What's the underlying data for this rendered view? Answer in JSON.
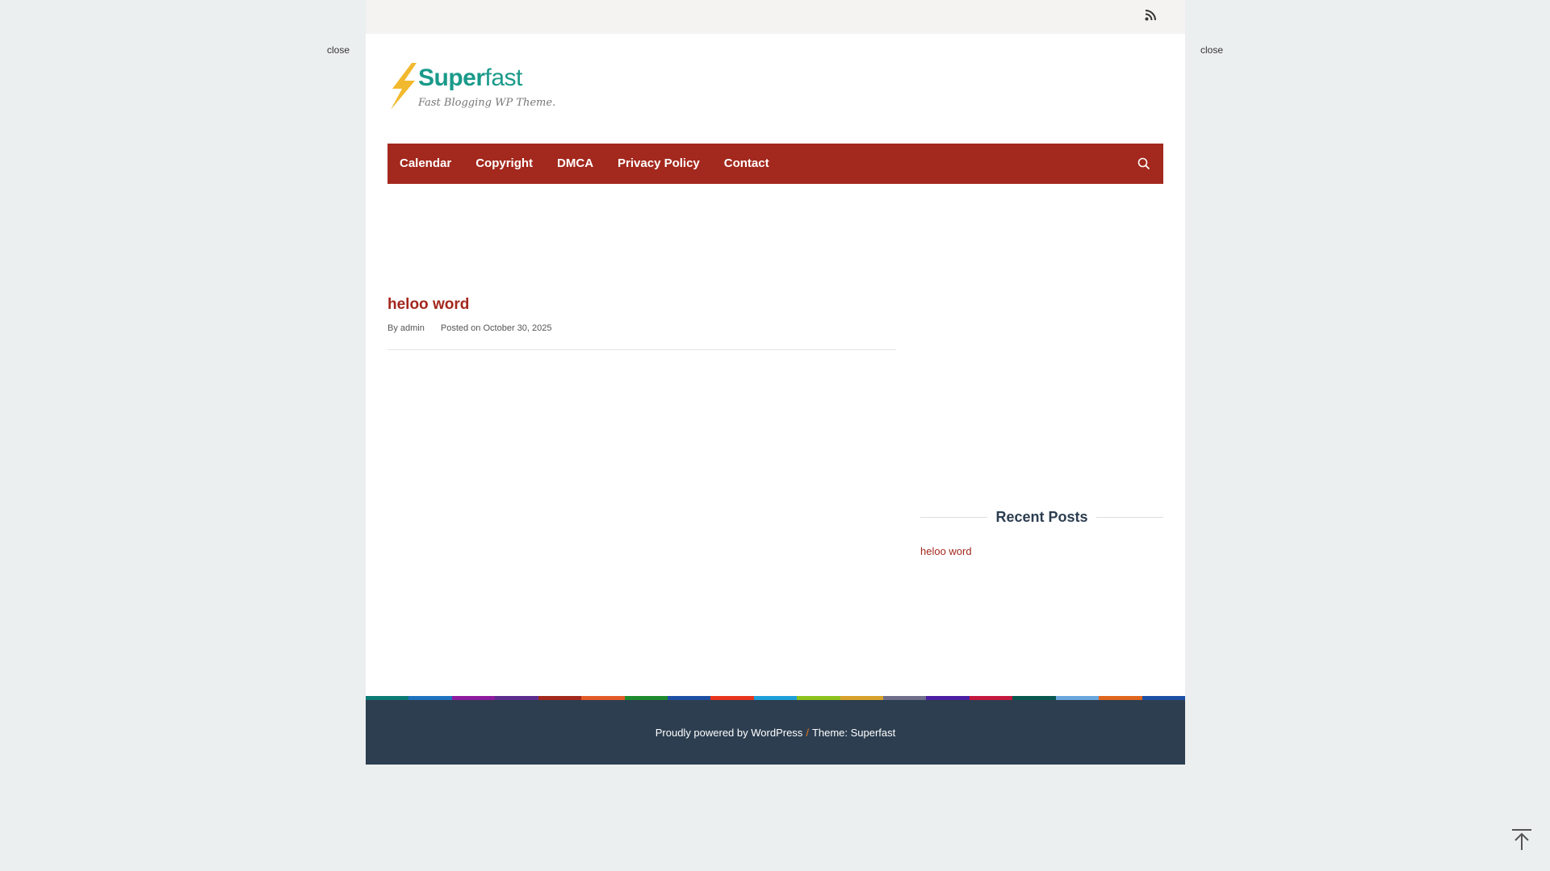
{
  "close_left": "close",
  "close_right": "close",
  "logo": {
    "title_a": "Super",
    "title_b": "fast",
    "tagline": "Fast Blogging WP Theme."
  },
  "nav": {
    "items": [
      {
        "label": "Calendar"
      },
      {
        "label": "Copyright"
      },
      {
        "label": "DMCA"
      },
      {
        "label": "Privacy Policy"
      },
      {
        "label": "Contact"
      }
    ]
  },
  "post": {
    "title": "heloo word",
    "by_label": "By",
    "author": "admin",
    "posted_label": "Posted on",
    "date": "October 30, 2025"
  },
  "sidebar": {
    "widget_title": "Recent Posts",
    "recent": [
      {
        "label": "heloo word"
      }
    ]
  },
  "footer": {
    "powered": "Proudly powered by WordPress",
    "separator": "/",
    "theme": "Theme: Superfast"
  },
  "colors": {
    "brand": "#a3281d",
    "footer_bg": "#2d3e50",
    "logo_teal": "#1a9a8a",
    "bolt": "#f1b92e",
    "stripe": [
      "#0b7a73",
      "#1e73be",
      "#8e1b9e",
      "#5b2d8e",
      "#a3281d",
      "#e35a28",
      "#1e8a2e",
      "#1e4fa3",
      "#e8341c",
      "#1ea0d8",
      "#8cc21e",
      "#d8a12a",
      "#6e6e8a",
      "#4a1fa3",
      "#c4173d",
      "#07574f",
      "#6aa6de",
      "#e0651e",
      "#1e4fa3"
    ]
  },
  "icons": {
    "rss": "rss-icon",
    "search": "search-icon",
    "back_to_top": "arrow-up-icon"
  }
}
